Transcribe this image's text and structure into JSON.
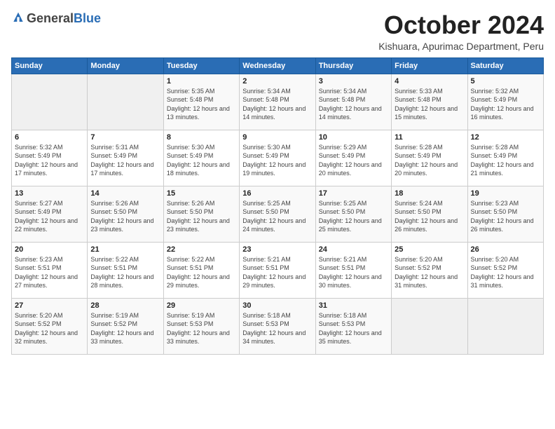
{
  "logo": {
    "general": "General",
    "blue": "Blue"
  },
  "header": {
    "month_year": "October 2024",
    "location": "Kishuara, Apurimac Department, Peru"
  },
  "days_of_week": [
    "Sunday",
    "Monday",
    "Tuesday",
    "Wednesday",
    "Thursday",
    "Friday",
    "Saturday"
  ],
  "weeks": [
    [
      {
        "day": "",
        "empty": true
      },
      {
        "day": "",
        "empty": true
      },
      {
        "day": "1",
        "sunrise": "5:35 AM",
        "sunset": "5:48 PM",
        "daylight": "12 hours and 13 minutes."
      },
      {
        "day": "2",
        "sunrise": "5:34 AM",
        "sunset": "5:48 PM",
        "daylight": "12 hours and 14 minutes."
      },
      {
        "day": "3",
        "sunrise": "5:34 AM",
        "sunset": "5:48 PM",
        "daylight": "12 hours and 14 minutes."
      },
      {
        "day": "4",
        "sunrise": "5:33 AM",
        "sunset": "5:48 PM",
        "daylight": "12 hours and 15 minutes."
      },
      {
        "day": "5",
        "sunrise": "5:32 AM",
        "sunset": "5:49 PM",
        "daylight": "12 hours and 16 minutes."
      }
    ],
    [
      {
        "day": "6",
        "sunrise": "5:32 AM",
        "sunset": "5:49 PM",
        "daylight": "12 hours and 17 minutes."
      },
      {
        "day": "7",
        "sunrise": "5:31 AM",
        "sunset": "5:49 PM",
        "daylight": "12 hours and 17 minutes."
      },
      {
        "day": "8",
        "sunrise": "5:30 AM",
        "sunset": "5:49 PM",
        "daylight": "12 hours and 18 minutes."
      },
      {
        "day": "9",
        "sunrise": "5:30 AM",
        "sunset": "5:49 PM",
        "daylight": "12 hours and 19 minutes."
      },
      {
        "day": "10",
        "sunrise": "5:29 AM",
        "sunset": "5:49 PM",
        "daylight": "12 hours and 20 minutes."
      },
      {
        "day": "11",
        "sunrise": "5:28 AM",
        "sunset": "5:49 PM",
        "daylight": "12 hours and 20 minutes."
      },
      {
        "day": "12",
        "sunrise": "5:28 AM",
        "sunset": "5:49 PM",
        "daylight": "12 hours and 21 minutes."
      }
    ],
    [
      {
        "day": "13",
        "sunrise": "5:27 AM",
        "sunset": "5:49 PM",
        "daylight": "12 hours and 22 minutes."
      },
      {
        "day": "14",
        "sunrise": "5:26 AM",
        "sunset": "5:50 PM",
        "daylight": "12 hours and 23 minutes."
      },
      {
        "day": "15",
        "sunrise": "5:26 AM",
        "sunset": "5:50 PM",
        "daylight": "12 hours and 23 minutes."
      },
      {
        "day": "16",
        "sunrise": "5:25 AM",
        "sunset": "5:50 PM",
        "daylight": "12 hours and 24 minutes."
      },
      {
        "day": "17",
        "sunrise": "5:25 AM",
        "sunset": "5:50 PM",
        "daylight": "12 hours and 25 minutes."
      },
      {
        "day": "18",
        "sunrise": "5:24 AM",
        "sunset": "5:50 PM",
        "daylight": "12 hours and 26 minutes."
      },
      {
        "day": "19",
        "sunrise": "5:23 AM",
        "sunset": "5:50 PM",
        "daylight": "12 hours and 26 minutes."
      }
    ],
    [
      {
        "day": "20",
        "sunrise": "5:23 AM",
        "sunset": "5:51 PM",
        "daylight": "12 hours and 27 minutes."
      },
      {
        "day": "21",
        "sunrise": "5:22 AM",
        "sunset": "5:51 PM",
        "daylight": "12 hours and 28 minutes."
      },
      {
        "day": "22",
        "sunrise": "5:22 AM",
        "sunset": "5:51 PM",
        "daylight": "12 hours and 29 minutes."
      },
      {
        "day": "23",
        "sunrise": "5:21 AM",
        "sunset": "5:51 PM",
        "daylight": "12 hours and 29 minutes."
      },
      {
        "day": "24",
        "sunrise": "5:21 AM",
        "sunset": "5:51 PM",
        "daylight": "12 hours and 30 minutes."
      },
      {
        "day": "25",
        "sunrise": "5:20 AM",
        "sunset": "5:52 PM",
        "daylight": "12 hours and 31 minutes."
      },
      {
        "day": "26",
        "sunrise": "5:20 AM",
        "sunset": "5:52 PM",
        "daylight": "12 hours and 31 minutes."
      }
    ],
    [
      {
        "day": "27",
        "sunrise": "5:20 AM",
        "sunset": "5:52 PM",
        "daylight": "12 hours and 32 minutes."
      },
      {
        "day": "28",
        "sunrise": "5:19 AM",
        "sunset": "5:52 PM",
        "daylight": "12 hours and 33 minutes."
      },
      {
        "day": "29",
        "sunrise": "5:19 AM",
        "sunset": "5:53 PM",
        "daylight": "12 hours and 33 minutes."
      },
      {
        "day": "30",
        "sunrise": "5:18 AM",
        "sunset": "5:53 PM",
        "daylight": "12 hours and 34 minutes."
      },
      {
        "day": "31",
        "sunrise": "5:18 AM",
        "sunset": "5:53 PM",
        "daylight": "12 hours and 35 minutes."
      },
      {
        "day": "",
        "empty": true
      },
      {
        "day": "",
        "empty": true
      }
    ]
  ],
  "labels": {
    "sunrise_prefix": "Sunrise: ",
    "sunset_prefix": "Sunset: ",
    "daylight_prefix": "Daylight: "
  }
}
